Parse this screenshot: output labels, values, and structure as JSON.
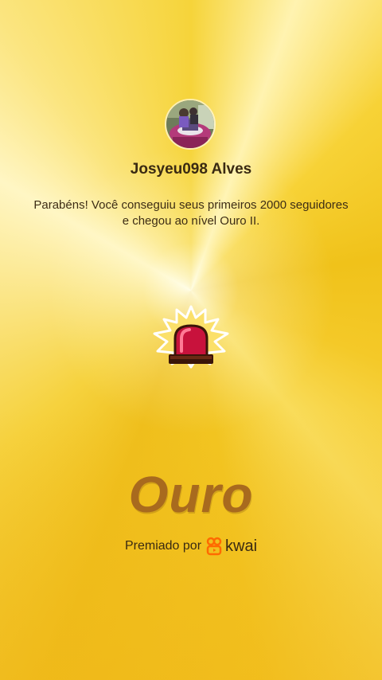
{
  "profile": {
    "username": "Josyeu098 Alves",
    "avatar_icon": "user-avatar-photo"
  },
  "notification": {
    "message": "Parabéns! Você conseguiu seus primeiros 2000 seguidores e chegou ao nível Ouro II."
  },
  "badge": {
    "icon": "siren-icon",
    "level_title": "Ouro"
  },
  "footer": {
    "awarded_by": "Premiado por",
    "brand_name": "kwai",
    "brand_icon": "kwai-logo-icon"
  },
  "colors": {
    "background": "#f2c21c",
    "level_title": "#a86a1e",
    "siren_red": "#c8123c",
    "brand_orange": "#ff6a00"
  }
}
